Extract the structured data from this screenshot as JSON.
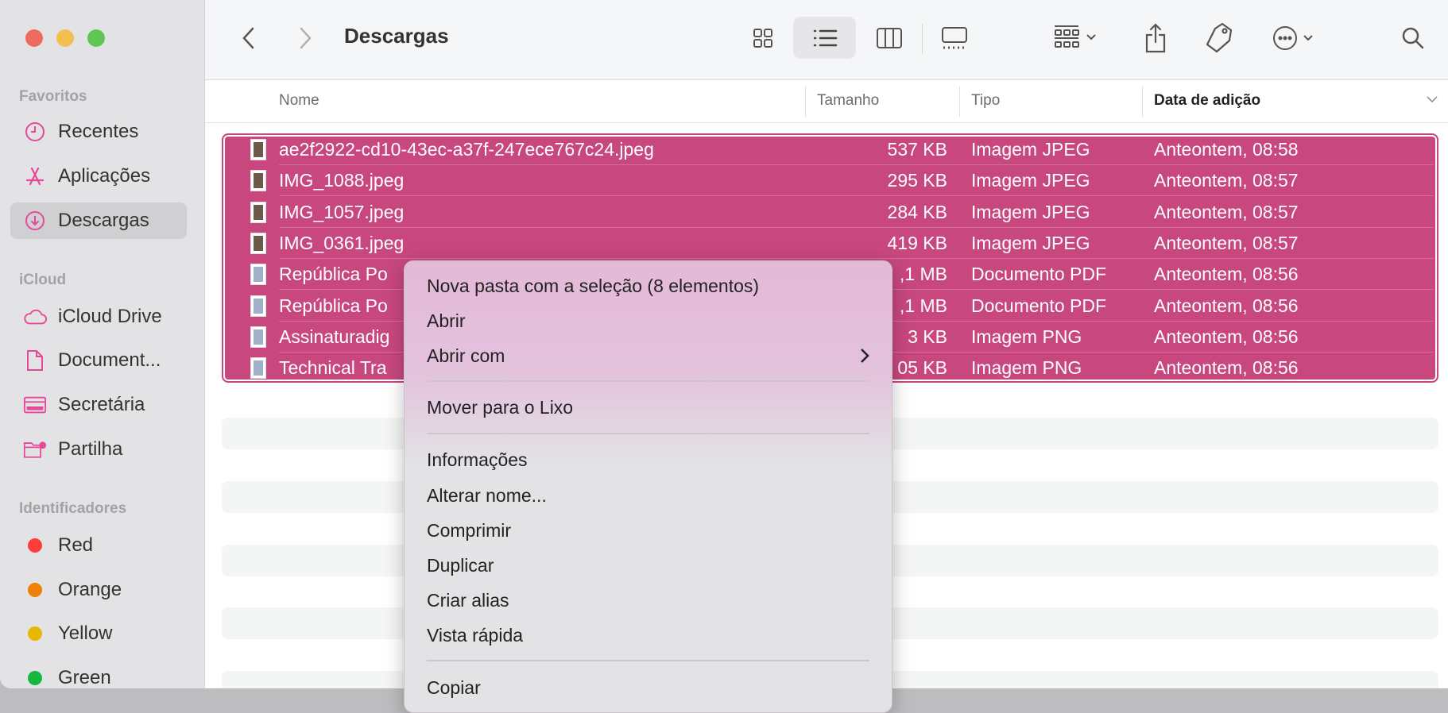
{
  "window": {
    "title": "Descargas"
  },
  "sidebar": {
    "sections": [
      {
        "label": "Favoritos"
      },
      {
        "label": "iCloud"
      },
      {
        "label": "Identificadores"
      }
    ],
    "favorites": [
      {
        "label": "Recentes",
        "icon": "clock-icon"
      },
      {
        "label": "Aplicações",
        "icon": "applications-icon"
      },
      {
        "label": "Descargas",
        "icon": "download-icon",
        "selected": true
      }
    ],
    "icloud": [
      {
        "label": "iCloud Drive",
        "icon": "cloud-icon"
      },
      {
        "label": "Document...",
        "icon": "document-icon"
      },
      {
        "label": "Secretária",
        "icon": "desktop-icon"
      },
      {
        "label": "Partilha",
        "icon": "shared-folder-icon"
      }
    ],
    "tags": [
      {
        "label": "Red",
        "color": "#fc3d39"
      },
      {
        "label": "Orange",
        "color": "#ee8206"
      },
      {
        "label": "Yellow",
        "color": "#e8b800"
      },
      {
        "label": "Green",
        "color": "#14b83d"
      }
    ]
  },
  "columns": {
    "name": "Nome",
    "size": "Tamanho",
    "kind": "Tipo",
    "date": "Data de adição"
  },
  "files": [
    {
      "name": "ae2f2922-cd10-43ec-a37f-247ece767c24.jpeg",
      "size": "537 KB",
      "kind": "Imagem JPEG",
      "date": "Anteontem, 08:58"
    },
    {
      "name": "IMG_1088.jpeg",
      "size": "295 KB",
      "kind": "Imagem JPEG",
      "date": "Anteontem, 08:57"
    },
    {
      "name": "IMG_1057.jpeg",
      "size": "284 KB",
      "kind": "Imagem JPEG",
      "date": "Anteontem, 08:57"
    },
    {
      "name": "IMG_0361.jpeg",
      "size": "419 KB",
      "kind": "Imagem JPEG",
      "date": "Anteontem, 08:57"
    },
    {
      "name": "República Po",
      "size": ",1 MB",
      "kind": "Documento PDF",
      "date": "Anteontem, 08:56"
    },
    {
      "name": "República Po",
      "size": ",1 MB",
      "kind": "Documento PDF",
      "date": "Anteontem, 08:56"
    },
    {
      "name": "Assinaturadig",
      "size": "3 KB",
      "kind": "Imagem PNG",
      "date": "Anteontem, 08:56"
    },
    {
      "name": "Technical Tra",
      "size": "05 KB",
      "kind": "Imagem PNG",
      "date": "Anteontem, 08:56"
    }
  ],
  "context_menu": {
    "items": [
      "Nova pasta com a seleção (8 elementos)",
      "Abrir",
      "Abrir com",
      "Mover para o Lixo",
      "Informações",
      "Alterar nome...",
      "Comprimir",
      "Duplicar",
      "Criar alias",
      "Vista rápida",
      "Copiar"
    ]
  },
  "colors": {
    "selection": "#c8477f",
    "accent": "#e8489a"
  }
}
